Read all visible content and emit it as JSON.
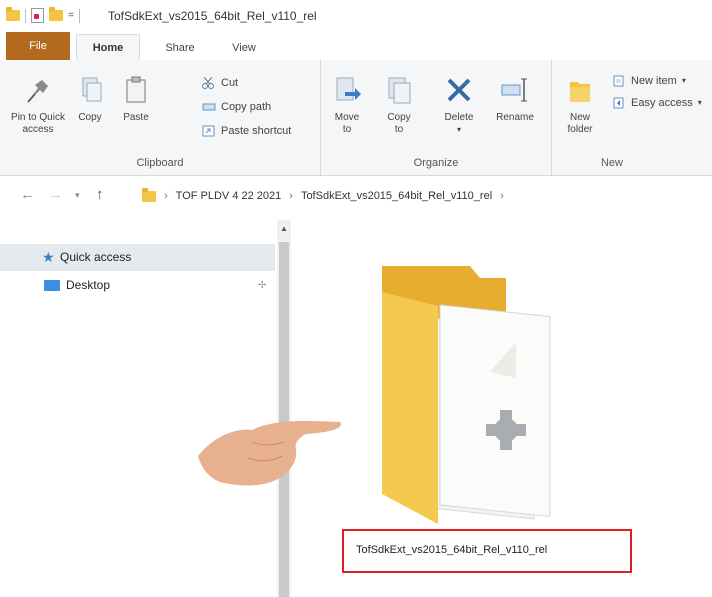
{
  "window": {
    "title": "TofSdkExt_vs2015_64bit_Rel_v110_rel",
    "quick_access_arrow": "="
  },
  "ribbon_tabs": [
    {
      "label": "File"
    },
    {
      "label": "Home"
    },
    {
      "label": "Share"
    },
    {
      "label": "View"
    }
  ],
  "ribbon": {
    "clipboard": {
      "group_label": "Clipboard",
      "pin_label_1": "Pin to Quick",
      "pin_label_2": "access",
      "copy_label": "Copy",
      "paste_label": "Paste",
      "cut_label": "Cut",
      "copy_path_label": "Copy path",
      "paste_shortcut_label": "Paste shortcut"
    },
    "organize": {
      "group_label": "Organize",
      "move_label_1": "Move",
      "move_label_2": "to",
      "copy_to_label_1": "Copy",
      "copy_to_label_2": "to",
      "delete_label": "Delete",
      "rename_label": "Rename"
    },
    "new": {
      "group_label": "New",
      "new_folder_label_1": "New",
      "new_folder_label_2": "folder",
      "new_item_label": "New item",
      "easy_access_label": "Easy access"
    }
  },
  "address": {
    "crumbs": [
      "TOF PLDV 4 22 2021",
      "TofSdkExt_vs2015_64bit_Rel_v110_rel"
    ],
    "separator": "›"
  },
  "nav_pane": {
    "items": [
      {
        "label": "Quick access",
        "selected": true
      },
      {
        "label": "Desktop",
        "pinned": true
      }
    ]
  },
  "content": {
    "folder_name": "TofSdkExt_vs2015_64bit_Rel_v110_rel"
  },
  "colors": {
    "file_tab": "#b46a1e",
    "folder_yellow": "#f4c542",
    "highlight_red": "#e02020",
    "selection": "#e5eaf0"
  }
}
